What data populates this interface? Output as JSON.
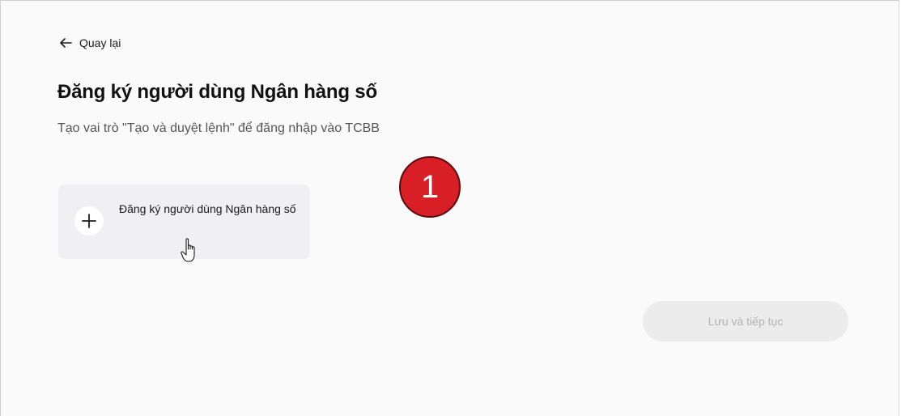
{
  "nav": {
    "back_label": "Quay lại"
  },
  "header": {
    "title": "Đăng ký người dùng Ngân hàng số",
    "subtitle": "Tạo vai trò \"Tạo và duyệt lệnh\" để đăng nhập vào TCBB"
  },
  "add_card": {
    "label": "Đăng ký người dùng Ngân hàng số",
    "icon": "plus-icon"
  },
  "annotation": {
    "step_number": "1",
    "color": "#d91f26"
  },
  "footer": {
    "save_label": "Lưu và tiếp tục",
    "save_enabled": false
  }
}
